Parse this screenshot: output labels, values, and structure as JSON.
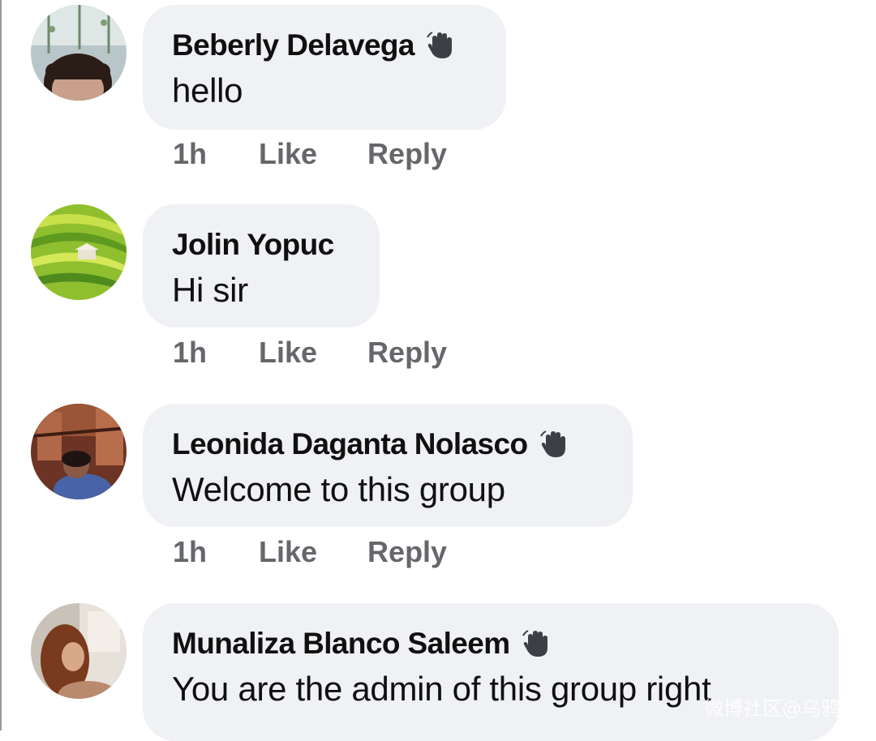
{
  "comments": [
    {
      "name": "Beberly Delavega",
      "badge": "wave-icon",
      "text": "hello",
      "time": "1h",
      "like": "Like",
      "reply": "Reply"
    },
    {
      "name": "Jolin Yopuc",
      "badge": "",
      "text": "Hi sir",
      "time": "1h",
      "like": "Like",
      "reply": "Reply"
    },
    {
      "name": "Leonida Daganta Nolasco",
      "badge": "wave-icon",
      "text": "Welcome to this group",
      "time": "1h",
      "like": "Like",
      "reply": "Reply"
    },
    {
      "name": "Munaliza Blanco Saleem",
      "badge": "wave-icon",
      "text": "You are the admin of this group right",
      "time": "",
      "like": "",
      "reply": ""
    }
  ],
  "watermark": "微博社区@乌鸦",
  "colors": {
    "bubble": "#eff1f4",
    "meta": "#65676b",
    "text": "#101010"
  }
}
